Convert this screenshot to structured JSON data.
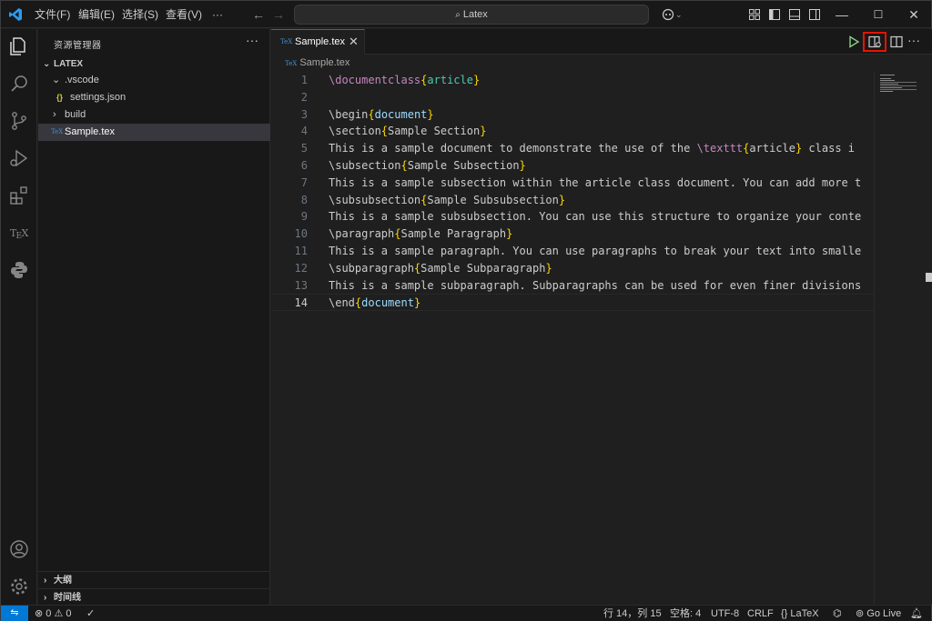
{
  "titlebar": {
    "menus": [
      "文件(F)",
      "编辑(E)",
      "选择(S)",
      "查看(V)",
      "···"
    ],
    "search_text": "Latex",
    "minimize": "—",
    "maximize": "☐",
    "close": "✕"
  },
  "sidebar": {
    "title": "资源管理器",
    "more": "···",
    "root": "LATEX",
    "items": [
      {
        "label": ".vscode",
        "kind": "folder-open"
      },
      {
        "label": "settings.json",
        "kind": "json"
      },
      {
        "label": "build",
        "kind": "folder"
      },
      {
        "label": "Sample.tex",
        "kind": "tex"
      }
    ],
    "outline": "大纲",
    "timeline": "时间线"
  },
  "editor": {
    "tab_label": "Sample.tex",
    "tab_icon": "TeX",
    "breadcrumb": "Sample.tex",
    "active_line": 14,
    "lines": [
      "\\documentclass{article}",
      "",
      "\\begin{document}",
      "\\section{Sample Section}",
      "This is a sample document to demonstrate the use of the \\texttt{article} class i",
      "\\subsection{Sample Subsection}",
      "This is a sample subsection within the article class document. You can add more t",
      "\\subsubsection{Sample Subsubsection}",
      "This is a sample subsubsection. You can use this structure to organize your conte",
      "\\paragraph{Sample Paragraph}",
      "This is a sample paragraph. You can use paragraphs to break your text into smalle",
      "\\subparagraph{Sample Subparagraph}",
      "This is a sample subparagraph. Subparagraphs can be used for even finer divisions",
      "\\end{document}"
    ]
  },
  "statusbar": {
    "errors": "0",
    "warnings": "0",
    "position": "行 14，列 15",
    "spaces": "空格: 4",
    "encoding": "UTF-8",
    "eol": "CRLF",
    "language": "LaTeX",
    "golive": "Go Live"
  },
  "colors": {
    "accent": "#0078d4",
    "highlight": "#e51400",
    "keyword": "#c586c0",
    "bracket": "#ffd700",
    "arg": "#4ec9b0"
  }
}
